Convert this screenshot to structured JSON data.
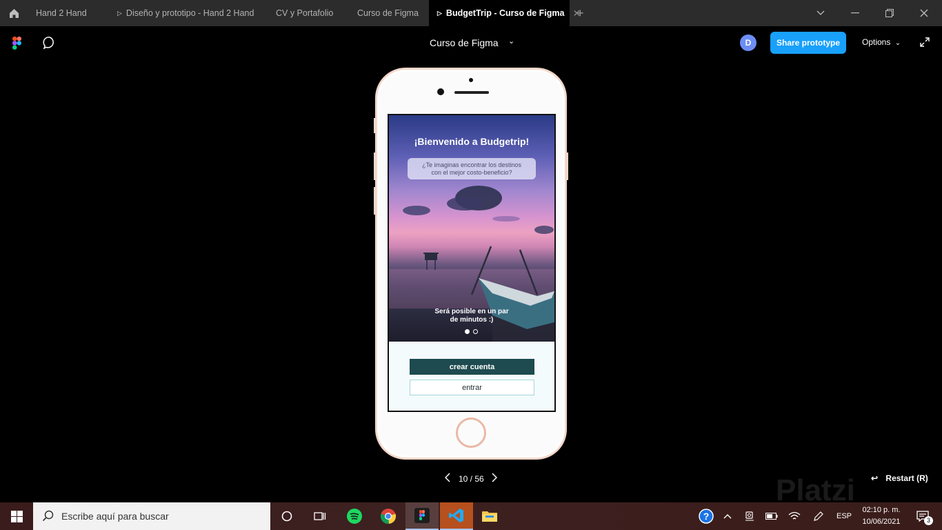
{
  "tabs": [
    {
      "label": "Hand 2 Hand",
      "has_play_icon": false,
      "active": false
    },
    {
      "label": "Diseño y prototipo - Hand 2 Hand",
      "has_play_icon": true,
      "active": false
    },
    {
      "label": "CV y Portafolio",
      "has_play_icon": false,
      "active": false
    },
    {
      "label": "Curso de Figma",
      "has_play_icon": false,
      "active": false
    },
    {
      "label": "BudgetTrip - Curso de Figma",
      "has_play_icon": true,
      "active": true
    }
  ],
  "toolbar": {
    "doc_title": "Curso de Figma",
    "avatar_initial": "D",
    "share_label": "Share prototype",
    "options_label": "Options"
  },
  "prototype": {
    "hero_title": "¡Bienvenido a Budgetrip!",
    "hero_subtitle_line1": "¿Te imaginas encontrar los destinos",
    "hero_subtitle_line2": "con el mejor costo-beneficio?",
    "caption_line1": "Será posible en un par",
    "caption_line2": "de minutos :)",
    "primary_button": "crear cuenta",
    "secondary_button": "entrar",
    "carousel_active_index": 0,
    "carousel_count": 2
  },
  "viewer": {
    "page_indicator": "10 / 56",
    "restart_label": "Restart (R)",
    "watermark": "Platzi"
  },
  "taskbar": {
    "search_placeholder": "Escribe aquí para buscar",
    "language": "ESP",
    "time": "02:10 p. m.",
    "date": "10/06/2021",
    "notifications_count": "3"
  },
  "colors": {
    "share_blue": "#18a0fb",
    "primary_button": "#1e4b4f",
    "tabbar_bg": "#2c2c2c"
  }
}
